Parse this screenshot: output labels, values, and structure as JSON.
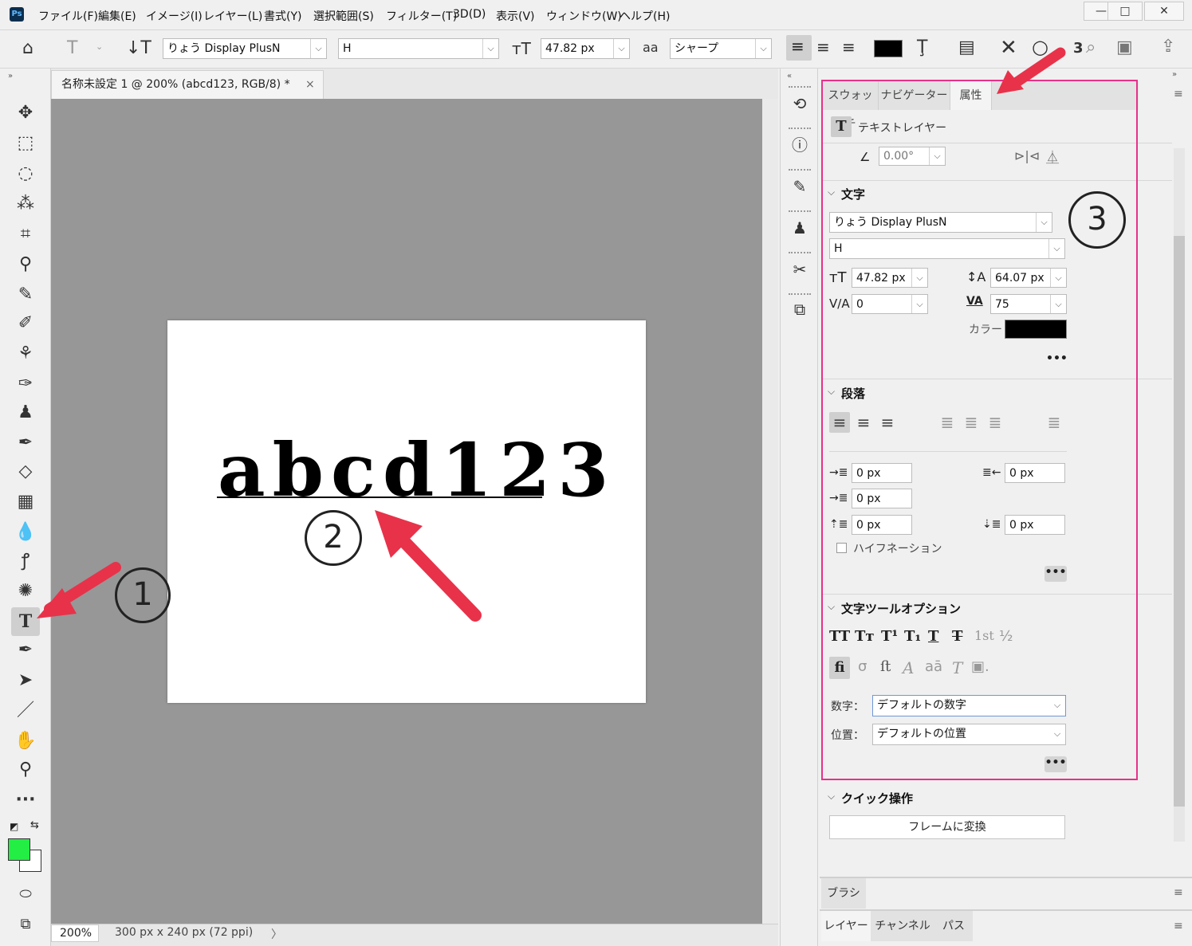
{
  "menubar": {
    "logo": "Ps",
    "items": [
      "ファイル(F)",
      "編集(E)",
      "イメージ(I)",
      "レイヤー(L)",
      "書式(Y)",
      "選択範囲(S)",
      "フィルター(T)",
      "3D(D)",
      "表示(V)",
      "ウィンドウ(W)",
      "ヘルプ(H)"
    ],
    "win_min": "—",
    "win_max": "□",
    "win_close": "✕"
  },
  "options": {
    "font_family": "りょう Display PlusN",
    "font_style": "H",
    "font_size": "47.82 px",
    "antialias": "シャープ",
    "aa_icon": "aa",
    "count": "3"
  },
  "document": {
    "tab_title": "名称未設定 1 @ 200% (abcd123, RGB/8) *",
    "close": "×",
    "sample_text": "abcd123"
  },
  "status": {
    "zoom": "200%",
    "size": "300 px x 240 px (72 ppi)",
    "arrow": "〉"
  },
  "colors": {
    "foreground": "#22ee44",
    "background": "#ffffff",
    "accent": "#e8318a",
    "arrow": "#e8324a"
  },
  "panel": {
    "tabs": [
      "スウォッチ",
      "ナビゲーター",
      "属性"
    ],
    "layer_type": "テキストレイヤー",
    "rotation": "0.00°",
    "character": {
      "title": "文字",
      "font_family": "りょう Display PlusN",
      "font_style": "H",
      "size": "47.82 px",
      "leading": "64.07 px",
      "kerning": "0",
      "tracking": "75",
      "color_label": "カラー",
      "color": "#000000"
    },
    "paragraph": {
      "title": "段落",
      "indent_left": "0 px",
      "indent_right": "0 px",
      "indent_first": "0 px",
      "space_before": "0 px",
      "space_after": "0 px",
      "hyphenation": "ハイフネーション"
    },
    "type_options": {
      "title": "文字ツールオプション",
      "numbers_label": "数字：",
      "numbers_value": "デフォルトの数字",
      "position_label": "位置：",
      "position_value": "デフォルトの位置",
      "glyphs": [
        "TT",
        "Tт",
        "T¹",
        "T₁",
        "T",
        "T",
        "1st",
        "½"
      ]
    },
    "quick": {
      "title": "クイック操作",
      "button": "フレームに変換"
    },
    "more": "•••"
  },
  "bottom_tabs": {
    "brush": "ブラシ",
    "layers": "レイヤー",
    "channels": "チャンネル",
    "paths": "パス"
  },
  "annotations": {
    "n1": "1",
    "n2": "2",
    "n3": "3"
  }
}
